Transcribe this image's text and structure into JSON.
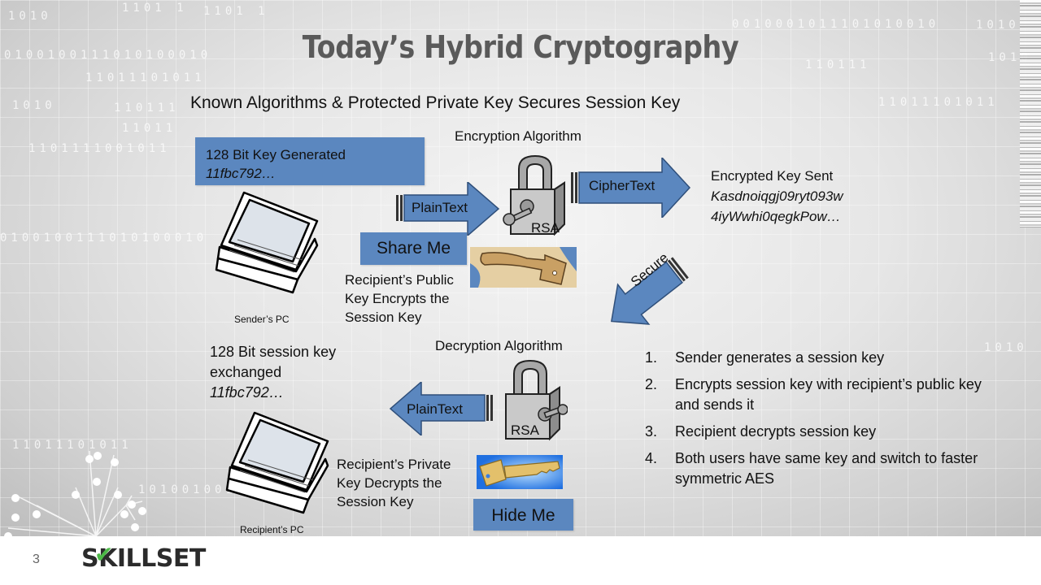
{
  "slide": {
    "title": "Today’s Hybrid Cryptography",
    "subtitle": "Known Algorithms & Protected Private Key Secures Session Key",
    "page_number": "3"
  },
  "brand": {
    "logo_text": "SKILLSET",
    "logo_check_color": "#4cb847",
    "accent_blue": "#5b87bf"
  },
  "background_binary": [
    "1101 1",
    "1101 1",
    "0010001011101010010",
    "1010",
    "0100100111010100010",
    "11011101011",
    "1010",
    "110111",
    "11011",
    "1101111001011",
    "1010",
    "110111",
    "11011101011",
    "1010",
    "0100100111010100010",
    "11011101011",
    "101001001",
    "1010"
  ],
  "sender": {
    "key_box_line1": "128 Bit Key Generated",
    "key_box_line2": "11fbc792…",
    "pc_label": "Sender’s PC"
  },
  "encryption": {
    "heading": "Encryption Algorithm",
    "lock_label": "RSA",
    "input_arrow": "PlainText",
    "output_arrow": "CipherText",
    "share_button": "Share Me",
    "public_key_caption": [
      "Recipient’s Public",
      "Key Encrypts the",
      "Session Key"
    ]
  },
  "encrypted_key": {
    "heading": "Encrypted Key Sent",
    "value_line1": "Kasdnoiqgj09ryt093w",
    "value_line2": "4iyWwhi0qegkPow…"
  },
  "transfer_arrow": "Secure",
  "recipient": {
    "session_key_line1": "128 Bit session key",
    "session_key_line2": "exchanged",
    "session_key_line3": "11fbc792…",
    "pc_label": "Recipient’s PC"
  },
  "decryption": {
    "heading": "Decryption Algorithm",
    "lock_label": "RSA",
    "output_arrow": "PlainText",
    "hide_button": "Hide Me",
    "private_key_caption": [
      "Recipient’s Private",
      "Key Decrypts the",
      "Session Key"
    ]
  },
  "steps": [
    {
      "num": "1.",
      "text": "Sender generates a session key"
    },
    {
      "num": "2.",
      "text": "Encrypts session key with  recipient’s public key and sends it"
    },
    {
      "num": "3.",
      "text": "Recipient decrypts session key"
    },
    {
      "num": "4.",
      "text": "Both users have same key and switch to faster symmetric AES"
    }
  ]
}
